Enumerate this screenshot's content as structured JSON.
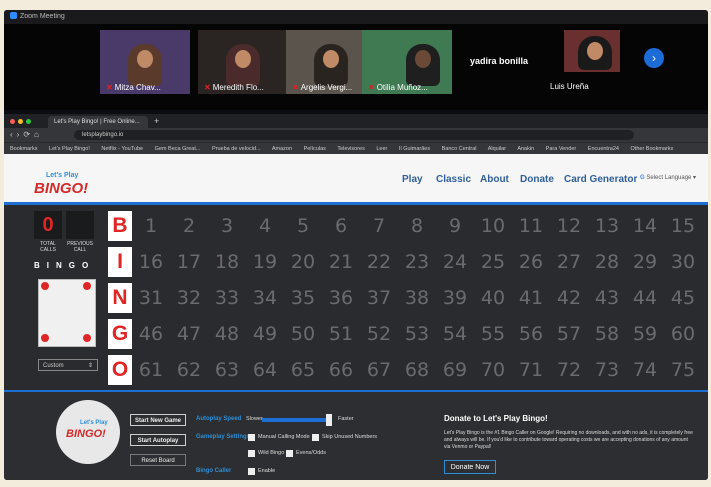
{
  "zoom": {
    "window_title": "Zoom Meeting",
    "participants": [
      {
        "name": "Mitza Chav..."
      },
      {
        "name": "Meredith Flo..."
      },
      {
        "name": "Argelis Vergi..."
      },
      {
        "name": "Otilia Muñoz..."
      }
    ],
    "name_only": [
      "yadira bonilla",
      "Luis Ureña"
    ]
  },
  "browser": {
    "tab_title": "Let's Play Bingo! | Free Online...",
    "url": "letsplaybingo.io",
    "bookmarks": [
      "Bookmarks",
      "Let's Play Bingo!",
      "Netflix - YouTube",
      "Gem Beca Great...",
      "Prueba de velocid...",
      "Amazon",
      "Películas",
      "Televisores",
      "Leer",
      "Il Guimarães",
      "Banco Central",
      "Alquilar",
      "Anakin",
      "Para Vender",
      "Encuentra24"
    ],
    "other_bookmarks": "Other Bookmarks"
  },
  "site": {
    "logo_top": "Let's Play",
    "logo_main": "BINGO!",
    "nav": [
      "Play",
      "Classic",
      "About",
      "Donate",
      "Card Generator"
    ],
    "language": "Select Language"
  },
  "board": {
    "current_number": "0",
    "previous_number": "",
    "total_calls_label": "TOTAL CALLS",
    "previous_call_label": "PREVIOUS CALL",
    "mini_bingo": "BINGO",
    "pattern_select": "Custom",
    "letters": [
      "B",
      "I",
      "N",
      "G",
      "O"
    ],
    "rows": [
      [
        "1",
        "2",
        "3",
        "4",
        "5",
        "6",
        "7",
        "8",
        "9",
        "10",
        "11",
        "12",
        "13",
        "14",
        "15"
      ],
      [
        "16",
        "17",
        "18",
        "19",
        "20",
        "21",
        "22",
        "23",
        "24",
        "25",
        "26",
        "27",
        "28",
        "29",
        "30"
      ],
      [
        "31",
        "32",
        "33",
        "34",
        "35",
        "36",
        "37",
        "38",
        "39",
        "40",
        "41",
        "42",
        "43",
        "44",
        "45"
      ],
      [
        "46",
        "47",
        "48",
        "49",
        "50",
        "51",
        "52",
        "53",
        "54",
        "55",
        "56",
        "57",
        "58",
        "59",
        "60"
      ],
      [
        "61",
        "62",
        "63",
        "64",
        "65",
        "66",
        "67",
        "68",
        "69",
        "70",
        "71",
        "72",
        "73",
        "74",
        "75"
      ]
    ],
    "called_color": "#e6e6e6",
    "uncalled_color": "#6a6b6f"
  },
  "controls": {
    "buttons": [
      "Start New Game",
      "Start Autoplay",
      "Reset Board"
    ],
    "autoplay_speed_label": "Autoplay Speed",
    "slower": "Slower",
    "faster": "Faster",
    "gameplay_settings_label": "Gameplay Settings",
    "bingo_caller_label": "Bingo Caller",
    "options": [
      "Manual Calling Mode",
      "Skip Unused Numbers",
      "Wild Bingo",
      "Evens/Odds",
      "Enable"
    ],
    "donate_title": "Donate to Let's Play Bingo!",
    "donate_text": "Let's Play Bingo is the #1 Bingo Caller on Google! Requiring no downloads, and with no ads, it is completely free and always will be. If you'd like to contribute toward operating costs we are accepting donations of any amount via Venmo or Paypal!",
    "donate_button": "Donate Now"
  }
}
